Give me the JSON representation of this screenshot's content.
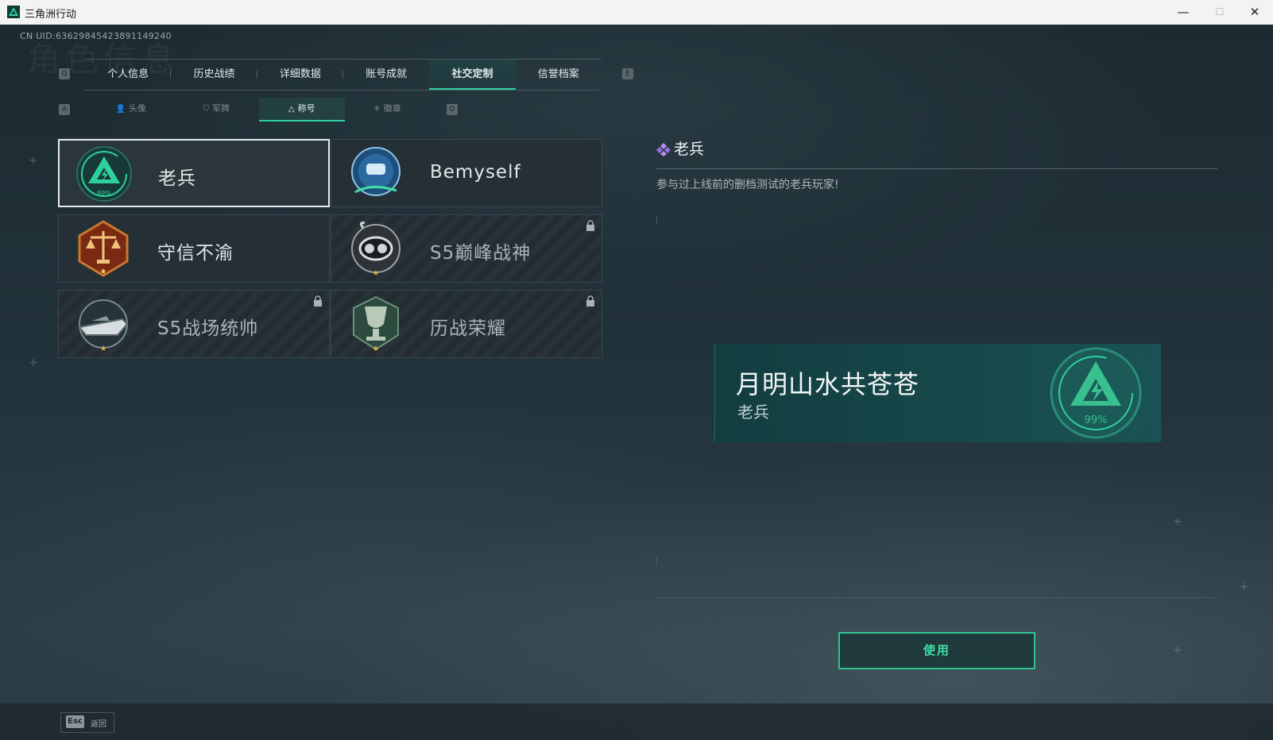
{
  "window": {
    "title": "三角洲行动",
    "minimize": "—",
    "maximize": "☐",
    "close": "✕"
  },
  "header": {
    "uid": "CN UID:6362984542389114924​0",
    "bg_title": "角色信息"
  },
  "keys": {
    "prev_tab": "Q",
    "next_tab": "E",
    "prev_sub": "A",
    "next_sub": "D"
  },
  "tabs": [
    {
      "label": "个人信息"
    },
    {
      "label": "历史战绩"
    },
    {
      "label": "详细数据"
    },
    {
      "label": "账号成就"
    },
    {
      "label": "社交定制",
      "active": true
    },
    {
      "label": "信誉档案"
    }
  ],
  "subtabs": [
    {
      "label": "头像",
      "icon": "person-icon"
    },
    {
      "label": "军牌",
      "icon": "dogtag-icon"
    },
    {
      "label": "称号",
      "icon": "triangle-icon",
      "active": true
    },
    {
      "label": "徽章",
      "icon": "badge-icon"
    }
  ],
  "titles": [
    {
      "label": "老兵",
      "emblem": "veteran-emblem-icon",
      "selected": true,
      "locked": false
    },
    {
      "label": "Bemyself",
      "emblem": "bemyself-emblem-icon",
      "selected": false,
      "locked": false
    },
    {
      "label": "守信不渝",
      "emblem": "scales-emblem-icon",
      "selected": false,
      "locked": false
    },
    {
      "label": "S5巅峰战神",
      "emblem": "diver-emblem-icon",
      "selected": false,
      "locked": true
    },
    {
      "label": "S5战场统帅",
      "emblem": "boat-emblem-icon",
      "selected": false,
      "locked": true
    },
    {
      "label": "历战荣耀",
      "emblem": "trophy-emblem-icon",
      "selected": false,
      "locked": true
    }
  ],
  "detail": {
    "name": "老兵",
    "description": "参与过上线前的删档测试的老兵玩家!"
  },
  "banner": {
    "title": "月明山水共苍苍",
    "subtitle": "老兵",
    "emblem_text": "99%"
  },
  "emblem_percent": "99%",
  "use_button": "使用",
  "footer": {
    "esc_key": "Esc",
    "esc_label": "返回"
  },
  "colors": {
    "accent": "#2fd0a0",
    "banner": "#16484a"
  }
}
